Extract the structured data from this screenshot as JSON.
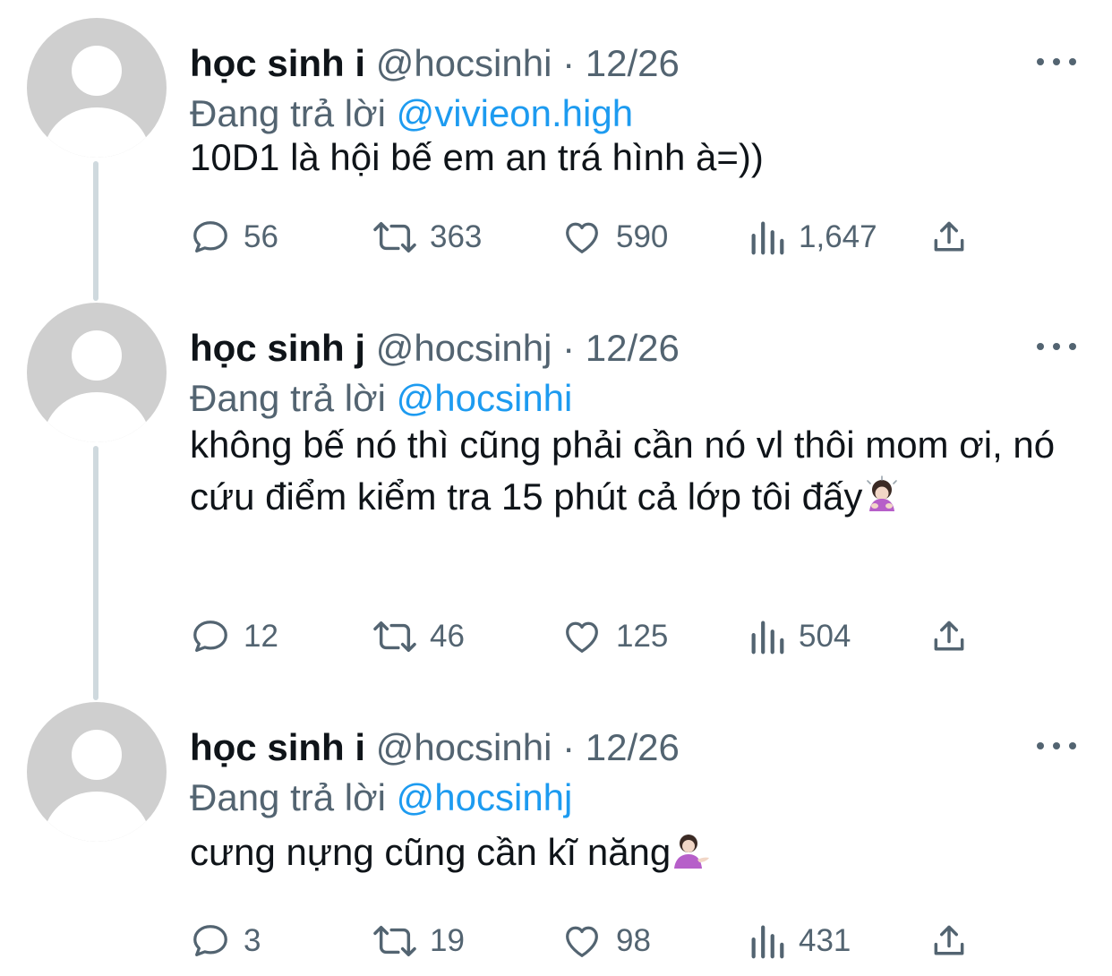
{
  "tweets": [
    {
      "name": "học sinh i",
      "handle": "@hocsinhi",
      "separator": "·",
      "date": "12/26",
      "reply_prefix": "Đang trả lời",
      "reply_mention": "@vivieon.high",
      "text": "10D1 là hội bế em an trá hình à=))",
      "replies": "56",
      "retweets": "363",
      "likes": "590",
      "views": "1,647"
    },
    {
      "name": "học sinh j",
      "handle": "@hocsinhj",
      "separator": "·",
      "date": "12/26",
      "reply_prefix": "Đang trả lời",
      "reply_mention": "@hocsinhi",
      "text": "không bế nó thì cũng phải cần nó vl thôi mom ơi, nó cứu điểm kiểm tra 15 phút cả lớp tôi đấy",
      "text_emoji": "person-bowing-emoji",
      "replies": "12",
      "retweets": "46",
      "likes": "125",
      "views": "504"
    },
    {
      "name": "học sinh i",
      "handle": "@hocsinhi",
      "separator": "·",
      "date": "12/26",
      "reply_prefix": "Đang trả lời",
      "reply_mention": "@hocsinhj",
      "text": "cưng nựng cũng cần kĩ năng",
      "text_emoji": "person-tipping-hand-emoji",
      "replies": "3",
      "retweets": "19",
      "likes": "98",
      "views": "431"
    }
  ],
  "icons": {
    "reply": "speech-bubble-icon",
    "retweet": "retweet-arrows-icon",
    "like": "heart-icon",
    "views": "bar-chart-icon",
    "share": "share-upload-icon",
    "more": "more-dots-icon"
  },
  "colors": {
    "text": "#0f1419",
    "secondary": "#536471",
    "link": "#1d9bf0",
    "thread_line": "#cfd9de",
    "avatar_bg": "#cfcfcf"
  }
}
